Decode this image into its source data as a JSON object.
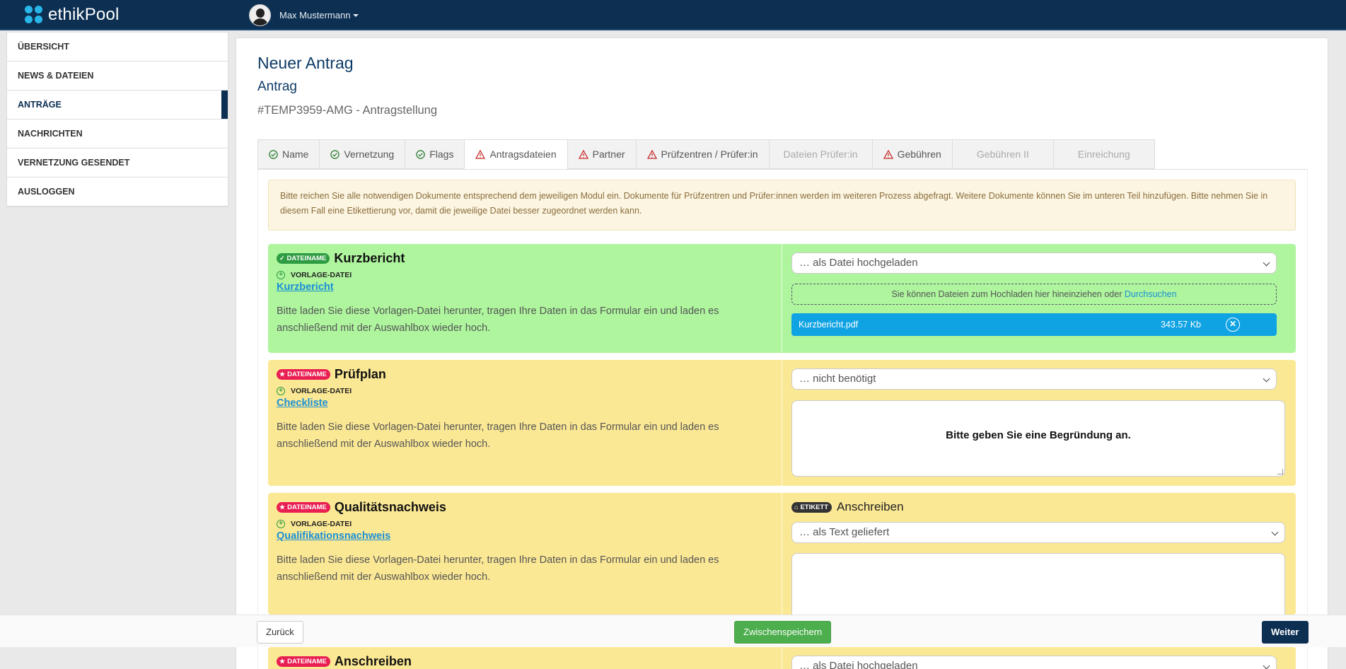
{
  "app": {
    "name": "ethikPool"
  },
  "user": {
    "name": "Max Mustermann"
  },
  "sidebar": {
    "items": [
      {
        "label": "ÜBERSICHT"
      },
      {
        "label": "NEWS & DATEIEN"
      },
      {
        "label": "ANTRÄGE",
        "active": true
      },
      {
        "label": "NACHRICHTEN"
      },
      {
        "label": "VERNETZUNG GESENDET"
      },
      {
        "label": "AUSLOGGEN"
      }
    ]
  },
  "page": {
    "title": "Neuer Antrag",
    "subtitle": "Antrag",
    "reference": "#TEMP3959-AMG - Antragstellung"
  },
  "tabs": [
    {
      "label": "Name",
      "icon": "check-circle-icon"
    },
    {
      "label": "Vernetzung",
      "icon": "check-circle-icon"
    },
    {
      "label": "Flags",
      "icon": "check-circle-icon"
    },
    {
      "label": "Antragsdateien",
      "icon": "warning-icon",
      "active": true
    },
    {
      "label": "Partner",
      "icon": "warning-icon"
    },
    {
      "label": "Prüfzentren / Prüfer:in",
      "icon": "warning-icon"
    },
    {
      "label": "Dateien Prüfer:in",
      "disabled": true
    },
    {
      "label": "Gebühren",
      "icon": "warning-icon"
    },
    {
      "label": "Gebühren II",
      "disabled": true
    },
    {
      "label": "Einreichung",
      "disabled": true
    }
  ],
  "alert": {
    "text": "Bitte reichen Sie alle notwendigen Dokumente entsprechend dem jeweiligen Modul ein. Dokumente für Prüfzentren und Prüfer:innen werden im weiteren Prozess abgefragt. Weitere Dokumente können Sie im unteren Teil hinzufügen. Bitte nehmen Sie in diesem Fall eine Etikettierung vor, damit die jeweilige Datei besser zugeordnet werden kann."
  },
  "common": {
    "badge_filename": "DATEINAME",
    "badge_tag": "ETIKETT",
    "template_label": "VORLAGE-DATEI",
    "template_desc": "Bitte laden Sie diese Vorlagen-Datei herunter, tragen Ihre Daten in das Formular ein und laden es anschließend mit der Auswahlbox wieder hoch."
  },
  "cards": [
    {
      "title": "Kurzbericht",
      "status": "ok",
      "template_link": "Kurzbericht",
      "select_value": "… als Datei hochgeladen",
      "dropzone_text": "Sie können Dateien zum Hochladen hier hineinziehen oder",
      "dropzone_link": "Durchsuchen",
      "file": {
        "name": "Kurzbericht.pdf",
        "size": "343.57 Kb"
      }
    },
    {
      "title": "Prüfplan",
      "status": "required",
      "template_link": "Checkliste",
      "select_value": "… nicht benötigt",
      "textarea_placeholder": "Bitte geben Sie eine Begründung an."
    },
    {
      "title": "Qualitätsnachweis",
      "status": "required",
      "template_link": "Qualifikationsnachweis",
      "tag_label": "Anschreiben",
      "select_value": "… als Text geliefert"
    },
    {
      "title": "Anschreiben",
      "status": "required",
      "select_value": "… als Datei hochgeladen"
    }
  ],
  "footer": {
    "back": "Zurück",
    "save": "Zwischenspeichern",
    "next": "Weiter"
  },
  "colors": {
    "navy": "#0c2f52",
    "green_card": "#aef59e",
    "yellow_card": "#fbe894",
    "file_blue": "#10a3e3",
    "required_pink": "#e91e52",
    "save_green": "#4cae4c"
  }
}
